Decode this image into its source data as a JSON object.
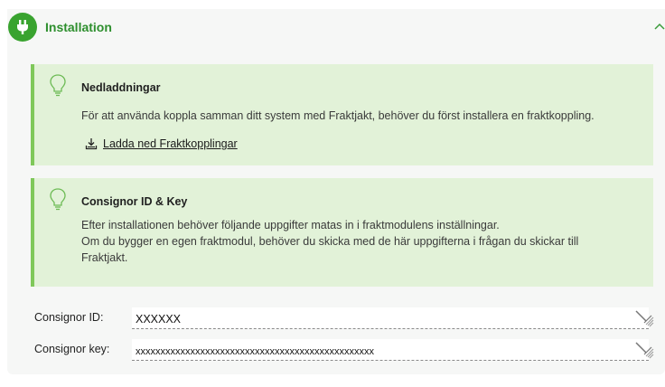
{
  "section": {
    "title": "Installation",
    "header_icon": "plug-icon",
    "collapse_icon": "chevron-up-icon",
    "accent_color": "#39a32f"
  },
  "downloads": {
    "icon": "lightbulb-icon",
    "title": "Nedladdningar",
    "text": "För att använda koppla samman ditt system med Fraktjakt, behöver du först installera en fraktkoppling.",
    "link_icon": "download-icon",
    "link_label": "Ladda ned Fraktkopplingar"
  },
  "consignor_info": {
    "icon": "lightbulb-icon",
    "title": "Consignor ID & Key",
    "line1": "Efter installationen behöver följande uppgifter matas in i fraktmodulens inställningar.",
    "line2": "Om du bygger en egen fraktmodul, behöver du skicka med de här uppgifterna i frågan du skickar till",
    "line3": "Fraktjakt."
  },
  "fields": {
    "consignor_id_label": "Consignor ID:",
    "consignor_id_value": "XXXXXX",
    "consignor_key_label": "Consignor key:",
    "consignor_key_value": "xxxxxxxxxxxxxxxxxxxxxxxxxxxxxxxxxxxxxxxxxxxxxxxx",
    "edit_icon": "edit-no-icon"
  }
}
